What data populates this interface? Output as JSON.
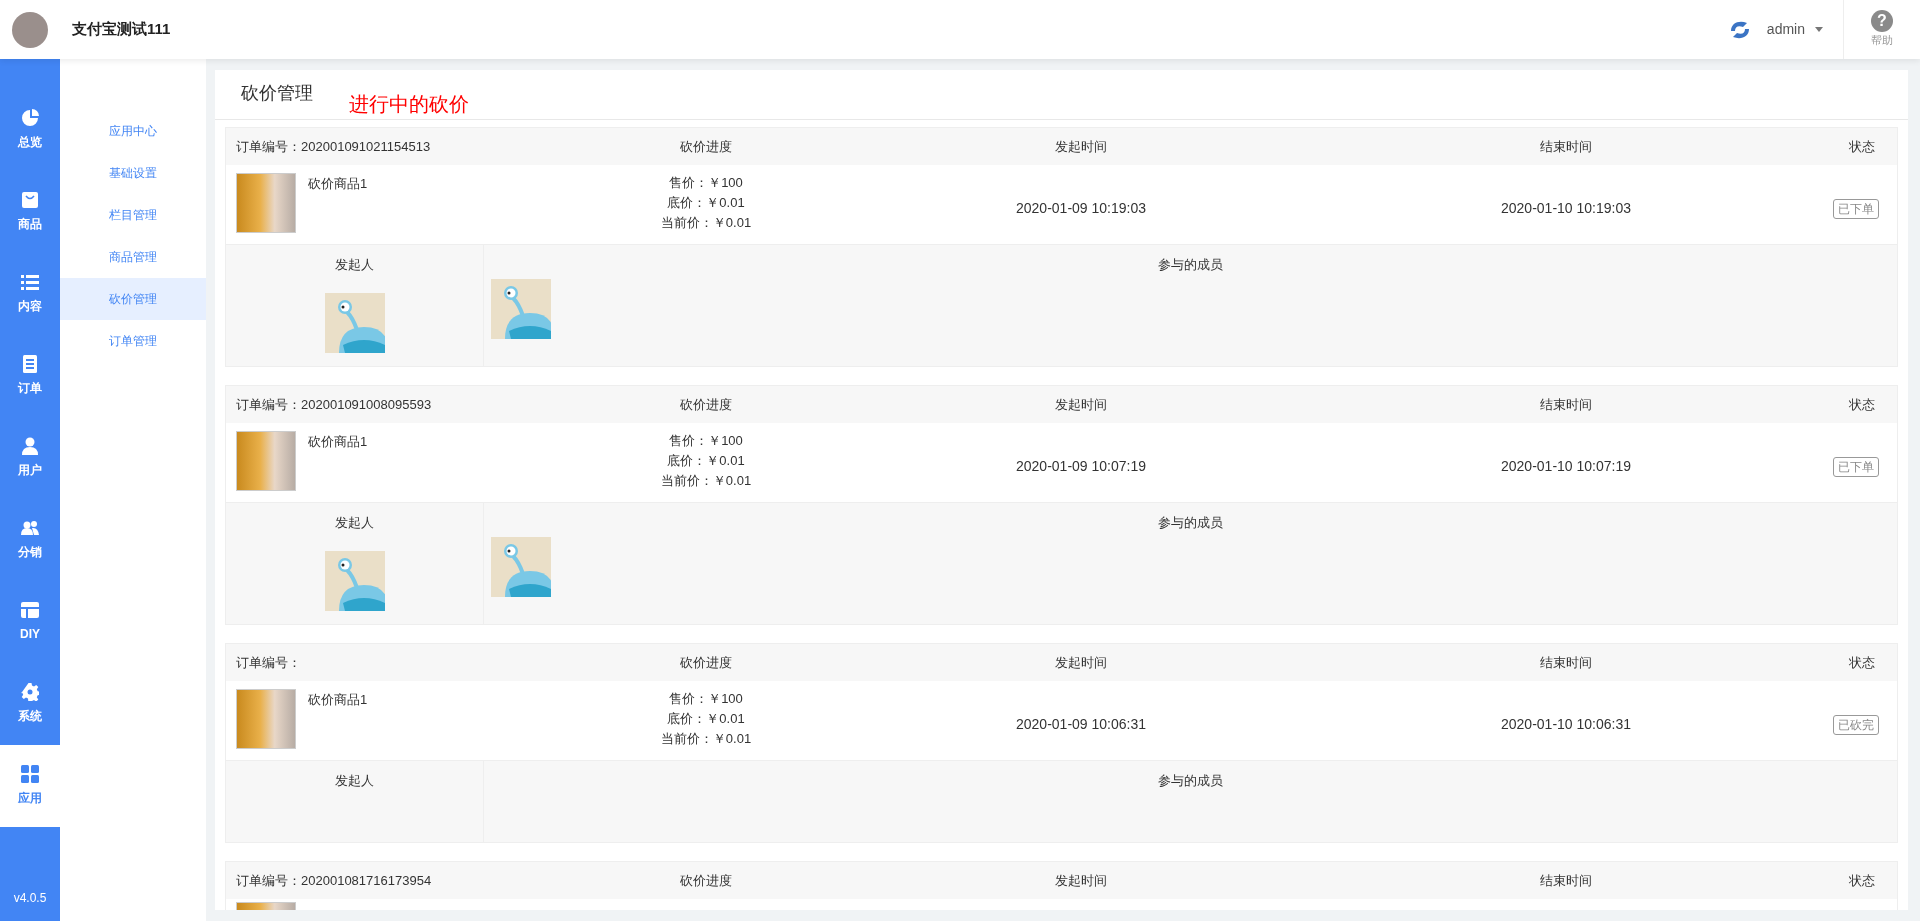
{
  "header": {
    "shop_name": "支付宝测试111",
    "user": "admin",
    "help": {
      "icon": "?",
      "label": "帮助"
    }
  },
  "rail": {
    "items": [
      {
        "label": "总览",
        "selected": false
      },
      {
        "label": "商品",
        "selected": false
      },
      {
        "label": "内容",
        "selected": false
      },
      {
        "label": "订单",
        "selected": false
      },
      {
        "label": "用户",
        "selected": false
      },
      {
        "label": "分销",
        "selected": false
      },
      {
        "label": "DIY",
        "selected": false
      },
      {
        "label": "系统",
        "selected": false
      },
      {
        "label": "应用",
        "selected": true
      }
    ],
    "version": "v4.0.5"
  },
  "submenu": {
    "items": [
      {
        "label": "应用中心",
        "selected": false
      },
      {
        "label": "基础设置",
        "selected": false
      },
      {
        "label": "栏目管理",
        "selected": false
      },
      {
        "label": "商品管理",
        "selected": false
      },
      {
        "label": "砍价管理",
        "selected": true
      },
      {
        "label": "订单管理",
        "selected": false
      }
    ]
  },
  "page": {
    "title": "砍价管理",
    "annotation": "进行中的砍价"
  },
  "orders": [
    {
      "order_no": "订单编号：202001091021154513",
      "columns": [
        "砍价进度",
        "发起时间",
        "结束时间",
        "状态"
      ],
      "product": {
        "name": "砍价商品1",
        "prices": [
          "售价：￥100",
          "底价：￥0.01",
          "当前价：￥0.01"
        ],
        "start": "2020-01-09 10:19:03",
        "end": "2020-01-10 10:19:03",
        "status": "已下单"
      },
      "initiator_label": "发起人",
      "members_label": "参与的成员",
      "initiator": {
        "kind": "avatar"
      },
      "members": [
        {
          "kind": "avatar"
        }
      ]
    },
    {
      "order_no": "订单编号：202001091008095593",
      "columns": [
        "砍价进度",
        "发起时间",
        "结束时间",
        "状态"
      ],
      "product": {
        "name": "砍价商品1",
        "prices": [
          "售价：￥100",
          "底价：￥0.01",
          "当前价：￥0.01"
        ],
        "start": "2020-01-09 10:07:19",
        "end": "2020-01-10 10:07:19",
        "status": "已下单"
      },
      "initiator_label": "发起人",
      "members_label": "参与的成员",
      "initiator": {
        "kind": "avatar"
      },
      "members": [
        {
          "kind": "avatar"
        }
      ]
    },
    {
      "order_no": "订单编号：",
      "columns": [
        "砍价进度",
        "发起时间",
        "结束时间",
        "状态"
      ],
      "product": {
        "name": "砍价商品1",
        "prices": [
          "售价：￥100",
          "底价：￥0.01",
          "当前价：￥0.01"
        ],
        "start": "2020-01-09 10:06:31",
        "end": "2020-01-10 10:06:31",
        "status": "已砍完"
      },
      "initiator_label": "发起人",
      "members_label": "参与的成员"
    },
    {
      "order_no": "订单编号：202001081716173954",
      "columns": [
        "砍价进度",
        "发起时间",
        "结束时间",
        "状态"
      ],
      "product": {
        "kind": "thumbnail_only"
      }
    }
  ]
}
